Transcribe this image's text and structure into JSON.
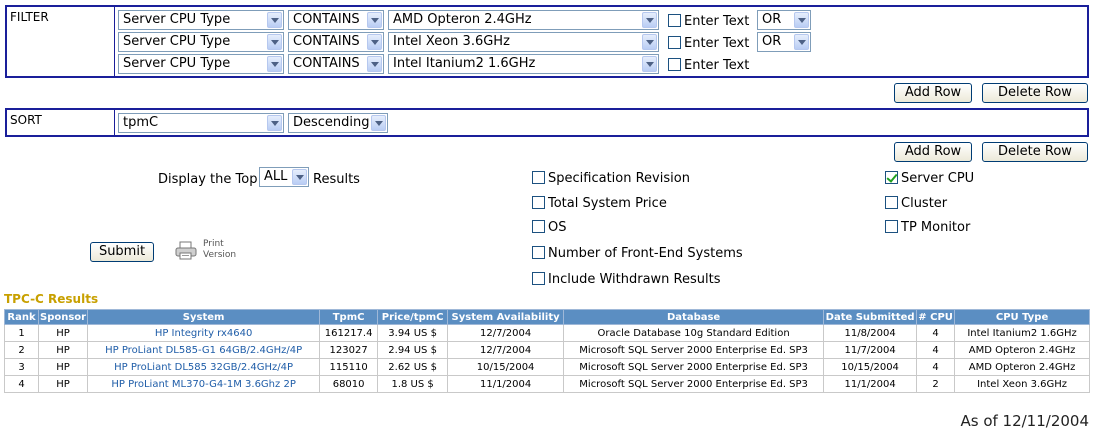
{
  "filter": {
    "label": "FILTER",
    "rows": [
      {
        "field": "Server CPU Type",
        "operator": "CONTAINS",
        "value": "AMD Opteron 2.4GHz",
        "enter_text_label": "Enter Text",
        "logic": "OR"
      },
      {
        "field": "Server CPU Type",
        "operator": "CONTAINS",
        "value": "Intel Xeon 3.6GHz",
        "enter_text_label": "Enter Text",
        "logic": "OR"
      },
      {
        "field": "Server CPU Type",
        "operator": "CONTAINS",
        "value": "Intel Itanium2 1.6GHz",
        "enter_text_label": "Enter Text",
        "logic": ""
      }
    ],
    "add_row": "Add Row",
    "delete_row": "Delete Row"
  },
  "sort": {
    "label": "SORT",
    "field": "tpmC",
    "order": "Descending",
    "add_row": "Add Row",
    "delete_row": "Delete Row"
  },
  "display": {
    "prefix": "Display the Top",
    "value": "ALL",
    "suffix": "Results"
  },
  "columns_options": {
    "left": [
      {
        "label": "Specification Revision",
        "checked": false
      },
      {
        "label": "Total System Price",
        "checked": false
      },
      {
        "label": "OS",
        "checked": false
      },
      {
        "label": "Number of Front-End Systems",
        "checked": false
      },
      {
        "label": "Include Withdrawn Results",
        "checked": false
      }
    ],
    "right": [
      {
        "label": "Server CPU",
        "checked": true
      },
      {
        "label": "Cluster",
        "checked": false
      },
      {
        "label": "TP Monitor",
        "checked": false
      }
    ]
  },
  "submit": "Submit",
  "print": {
    "line1": "Print",
    "line2": "Version",
    "icon": "printer-icon"
  },
  "results": {
    "title": "TPC-C Results",
    "headers": [
      "Rank",
      "Sponsor",
      "System",
      "TpmC",
      "Price/tpmC",
      "System Availability",
      "Database",
      "Date Submitted",
      "# CPU",
      "CPU Type"
    ],
    "rows": [
      [
        "1",
        "HP",
        "HP Integrity rx4640",
        "161217.4",
        "3.94 US $",
        "12/7/2004",
        "Oracle Database 10g Standard Edition",
        "11/8/2004",
        "4",
        "Intel Itanium2 1.6GHz"
      ],
      [
        "2",
        "HP",
        "HP ProLiant DL585-G1 64GB/2.4GHz/4P",
        "123027",
        "2.94 US $",
        "12/7/2004",
        "Microsoft SQL Server 2000 Enterprise Ed. SP3",
        "11/7/2004",
        "4",
        "AMD Opteron 2.4GHz"
      ],
      [
        "3",
        "HP",
        "HP ProLiant DL585 32GB/2.4GHz/4P",
        "115110",
        "2.62 US $",
        "10/15/2004",
        "Microsoft SQL Server 2000 Enterprise Ed. SP3",
        "10/15/2004",
        "4",
        "AMD Opteron 2.4GHz"
      ],
      [
        "4",
        "HP",
        "HP ProLiant ML370-G4-1M 3.6Ghz 2P",
        "68010",
        "1.8 US $",
        "11/1/2004",
        "Microsoft SQL Server 2000 Enterprise Ed. SP3",
        "11/1/2004",
        "2",
        "Intel Xeon 3.6GHz"
      ]
    ]
  },
  "as_of": "As of 12/11/2004",
  "colors": {
    "panel_border": "#1a1f9a",
    "header_bg": "#5b8ec2",
    "title": "#c8a000",
    "link": "#1f5da8"
  }
}
